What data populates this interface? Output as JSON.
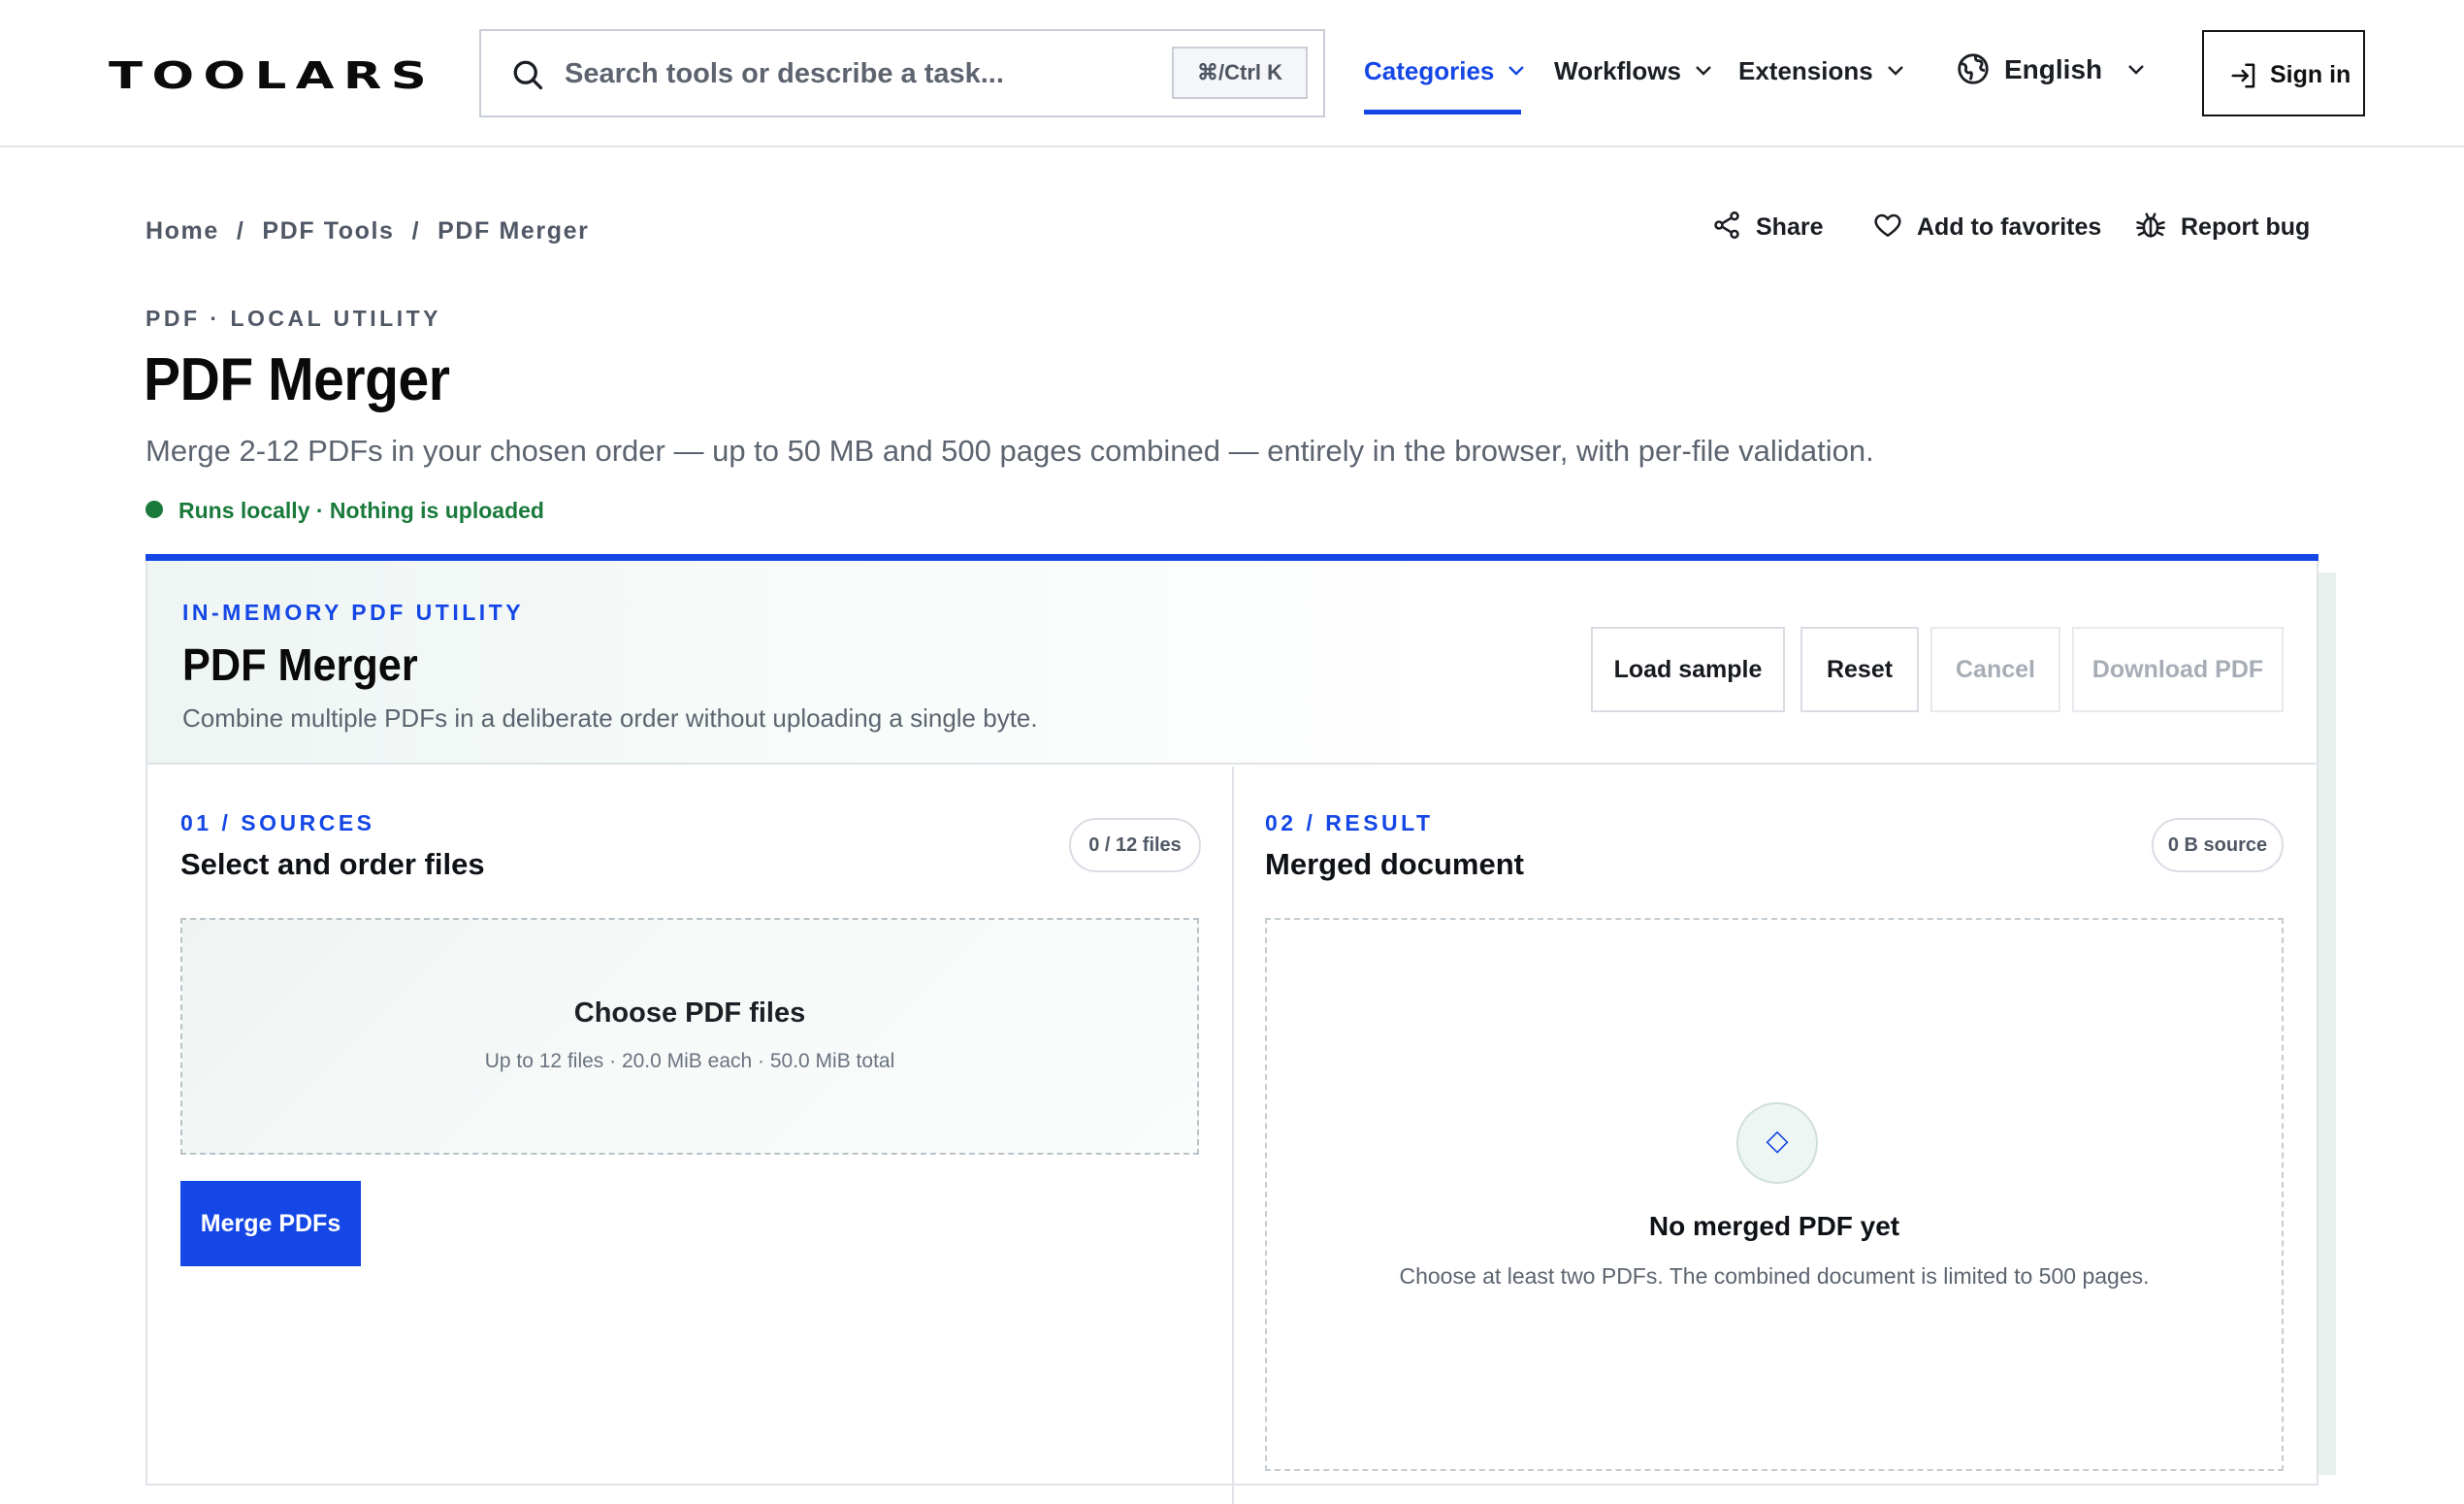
{
  "header": {
    "logo": "TOOLARS",
    "search_placeholder": "Search tools or describe a task...",
    "search_shortcut": "⌘/Ctrl K",
    "nav": {
      "categories": "Categories",
      "workflows": "Workflows",
      "extensions": "Extensions"
    },
    "language": "English",
    "sign_in": "Sign in",
    "accent_color": "#1447e6"
  },
  "breadcrumb": [
    "Home",
    "PDF Tools",
    "PDF Merger"
  ],
  "utility_actions": {
    "share": "Share",
    "favorites": "Add to favorites",
    "report": "Report bug"
  },
  "page": {
    "eyebrow": "PDF · LOCAL UTILITY",
    "title": "PDF Merger",
    "lead": "Merge 2-12 PDFs in your chosen order — up to 50 MB and 500 pages combined — entirely in the browser, with per-file validation.",
    "local_badge": "Runs locally · Nothing is uploaded",
    "local_color": "#1a7a3c"
  },
  "tool": {
    "eyebrow": "IN-MEMORY PDF UTILITY",
    "title": "PDF Merger",
    "subtitle": "Combine multiple PDFs in a deliberate order without uploading a single byte.",
    "buttons": {
      "load_sample": "Load sample",
      "reset": "Reset",
      "cancel": "Cancel",
      "download": "Download PDF"
    },
    "sources": {
      "eyebrow": "01 / SOURCES",
      "title": "Select and order files",
      "count_pill": "0 / 12 files",
      "dropzone_title": "Choose PDF files",
      "dropzone_sub": "Up to 12 files · 20.0 MiB each · 50.0 MiB total",
      "merge_button": "Merge PDFs"
    },
    "result": {
      "eyebrow": "02 / RESULT",
      "title": "Merged document",
      "size_pill": "0 B source",
      "empty_icon": "◇",
      "empty_title": "No merged PDF yet",
      "empty_sub": "Choose at least two PDFs. The combined document is limited to 500 pages."
    }
  }
}
